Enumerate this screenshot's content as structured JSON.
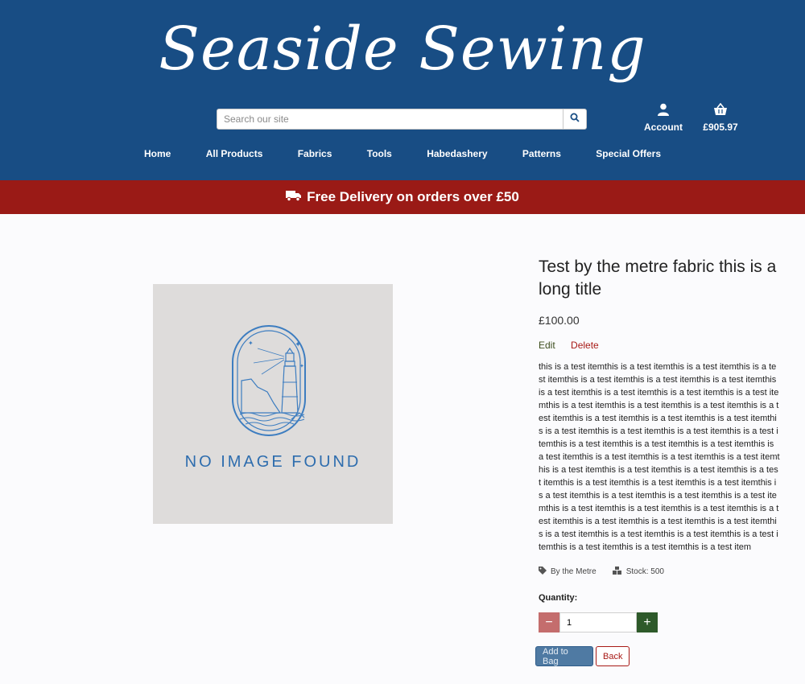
{
  "header": {
    "logo_text": "Seaside Sewing",
    "search": {
      "placeholder": "Search our site"
    },
    "account_label": "Account",
    "bag_total": "£905.97"
  },
  "nav": [
    "Home",
    "All Products",
    "Fabrics",
    "Tools",
    "Habedashery",
    "Patterns",
    "Special Offers"
  ],
  "banner": {
    "text": "Free Delivery on orders over £50"
  },
  "product": {
    "image_text": "NO IMAGE FOUND",
    "title": "Test by the metre fabric this is a long title",
    "price": "£100.00",
    "edit_label": "Edit",
    "delete_label": "Delete",
    "description": "this is a test itemthis is a test itemthis is a test itemthis is a test itemthis is a test itemthis is a test itemthis is a test itemthis is a test itemthis is a test itemthis is a test itemthis is a test itemthis is a test itemthis is a test itemthis is a test itemthis is a test itemthis is a test itemthis is a test itemthis is a test itemthis is a test itemthis is a test itemthis is a test itemthis is a test itemthis is a test itemthis is a test itemthis is a test itemthis is a test itemthis is a test itemthis is a test itemthis is a test itemthis is a test itemthis is a test itemthis is a test itemthis is a test itemthis is a test itemthis is a test itemthis is a test itemthis is a test itemthis is a test itemthis is a test itemthis is a test itemthis is a test itemthis is a test itemthis is a test itemthis is a test itemthis is a test itemthis is a test itemthis is a test itemthis is a test itemthis is a test itemthis is a test itemthis is a test itemthis is a test itemthis is a test itemthis is a test item",
    "category": "By the Metre",
    "stock": "Stock: 500",
    "quantity_label": "Quantity:",
    "quantity_value": "1",
    "add_to_bag_label": "Add to Bag",
    "back_label": "Back"
  },
  "colors": {
    "header_bg": "#184d84",
    "banner_bg": "#9a1a16",
    "minus_btn": "#c46d6d",
    "plus_btn": "#2e5a2a",
    "add_btn": "#4f7aa3"
  }
}
